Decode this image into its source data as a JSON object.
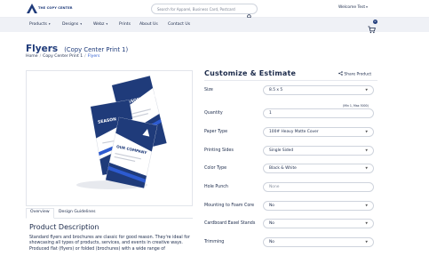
{
  "header": {
    "logo_text": "THE COPY CENTER",
    "search_placeholder": "Search for Apparel, Business Card, Postcard",
    "welcome": "Welcome Test"
  },
  "nav": {
    "items": [
      {
        "label": "Products",
        "has_caret": true
      },
      {
        "label": "Designs",
        "has_caret": true
      },
      {
        "label": "Webz",
        "has_caret": true
      },
      {
        "label": "Prints",
        "has_caret": false
      },
      {
        "label": "About Us",
        "has_caret": false
      },
      {
        "label": "Contact Us",
        "has_caret": false
      }
    ],
    "cart_count": "0"
  },
  "page": {
    "title": "Flyers",
    "subtitle": "(Copy Center Print 1)",
    "breadcrumb": [
      "Home",
      "Copy Center Print 1",
      "Flyers"
    ]
  },
  "product_image": {
    "flyer_headline": "SEASON COMPANY",
    "flyer_headline_2": "OUR COMPANY"
  },
  "tabs": [
    "Overview",
    "Design Guidelines"
  ],
  "description": {
    "title": "Product Description",
    "text": "Standard flyers and brochures are classic for good reason. They're ideal for showcasing all types of products, services, and events in creative ways. Produced flat (flyers) or folded (brochures) with a wide range of"
  },
  "customize": {
    "title": "Customize & Estimate",
    "share_label": "Share Product",
    "quantity_hint": "(Min 1, Max 5000)",
    "options": [
      {
        "label": "Size",
        "value": "8.5 x 5",
        "type": "select"
      },
      {
        "label": "Quantity",
        "value": "1",
        "type": "input"
      },
      {
        "label": "Paper Type",
        "value": "100# Heavy Matte Cover",
        "type": "select"
      },
      {
        "label": "Printing Sides",
        "value": "Single Sided",
        "type": "select"
      },
      {
        "label": "Color Type",
        "value": "Black & White",
        "type": "select"
      },
      {
        "label": "Hole Punch",
        "value": "None",
        "type": "placeholder"
      },
      {
        "label": "Mounting to Foam Core",
        "value": "No",
        "type": "select"
      },
      {
        "label": "Cardboard Easel Stands",
        "value": "No",
        "type": "select"
      },
      {
        "label": "Trimming",
        "value": "No",
        "type": "select"
      }
    ]
  },
  "colors": {
    "brand_navy": "#1f3b7a",
    "accent_blue": "#2d5bd0",
    "nav_bg": "#eff1f6"
  }
}
